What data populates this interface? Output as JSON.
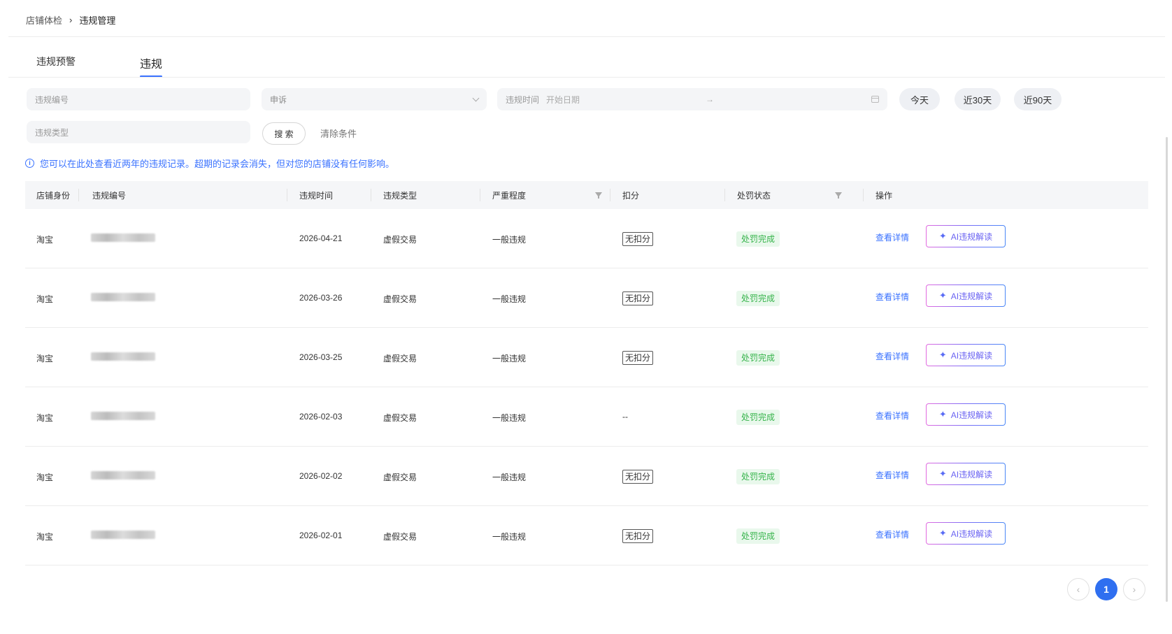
{
  "breadcrumb": {
    "items": [
      "店铺体检",
      "违规管理"
    ],
    "separator": "›"
  },
  "tabs": [
    "违规预警",
    "违规"
  ],
  "filters": {
    "id_placeholder": "违规编号",
    "appeal_value": "申诉",
    "date_label": "违规时间",
    "date_start_placeholder": "开始日期",
    "date_arrow": "→",
    "type_placeholder": "违规类型",
    "quick_ranges": [
      "今天",
      "近30天",
      "近90天"
    ],
    "search_label": "搜 索",
    "clear_label": "清除条件"
  },
  "notice": {
    "icon": "i",
    "text": "您可以在此处查看近两年的违规记录。超期的记录会消失，但对您的店铺没有任何影响。"
  },
  "table": {
    "headers": [
      "店铺身份",
      "违规编号",
      "违规时间",
      "违规类型",
      "严重程度",
      "扣分",
      "处罚状态",
      "操作"
    ],
    "rows": [
      {
        "role": "淘宝",
        "time": "2026-04-21",
        "type": "虚假交易",
        "severity": "一般违规",
        "score": "无扣分",
        "status": "处罚完成",
        "detail": "查看详情",
        "ai": "AI违规解读"
      },
      {
        "role": "淘宝",
        "time": "2026-03-26",
        "type": "虚假交易",
        "severity": "一般违规",
        "score": "无扣分",
        "status": "处罚完成",
        "detail": "查看详情",
        "ai": "AI违规解读"
      },
      {
        "role": "淘宝",
        "time": "2026-03-25",
        "type": "虚假交易",
        "severity": "一般违规",
        "score": "无扣分",
        "status": "处罚完成",
        "detail": "查看详情",
        "ai": "AI违规解读"
      },
      {
        "role": "淘宝",
        "time": "2026-02-03",
        "type": "虚假交易",
        "severity": "一般违规",
        "score": "--",
        "status": "处罚完成",
        "detail": "查看详情",
        "ai": "AI违规解读"
      },
      {
        "role": "淘宝",
        "time": "2026-02-02",
        "type": "虚假交易",
        "severity": "一般违规",
        "score": "无扣分",
        "status": "处罚完成",
        "detail": "查看详情",
        "ai": "AI违规解读"
      },
      {
        "role": "淘宝",
        "time": "2026-02-01",
        "type": "虚假交易",
        "severity": "一般违规",
        "score": "无扣分",
        "status": "处罚完成",
        "detail": "查看详情",
        "ai": "AI违规解读"
      }
    ]
  },
  "pagination": {
    "prev": "‹",
    "current": "1",
    "next": "›"
  },
  "colors": {
    "accent": "#3a72ff",
    "status_green": "#35b34a",
    "status_bg": "#e9f8ec"
  }
}
